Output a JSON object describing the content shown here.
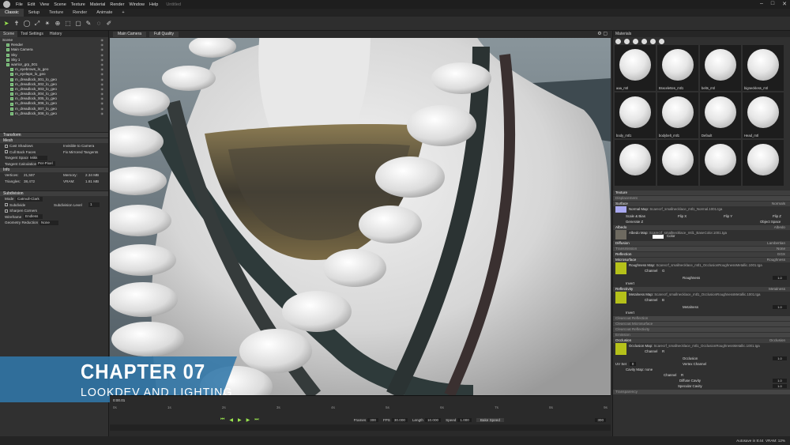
{
  "app": {
    "window_title": "Untitled"
  },
  "menu": [
    "File",
    "Edit",
    "View",
    "Scene",
    "Texture",
    "Material",
    "Render",
    "Window",
    "Help"
  ],
  "tabs": [
    {
      "label": "Classic"
    },
    {
      "label": "Setup"
    },
    {
      "label": "Texture"
    },
    {
      "label": "Render"
    },
    {
      "label": "Animate"
    },
    {
      "label": "+"
    }
  ],
  "left": {
    "tabs": [
      "Scene",
      "Tool Settings",
      "History"
    ],
    "tree": [
      "Scene",
      "Render",
      "Main Camera",
      "Sky",
      "Sky 1",
      "warrior_grp_001",
      "m_eyebrows_lo_geo",
      "m_eyelaps_lo_geo",
      "m_dreadlock_001_lo_geo",
      "m_dreadlock_002_lo_geo",
      "m_dreadlock_003_lo_geo",
      "m_dreadlock_004_lo_geo",
      "m_dreadlock_005_lo_geo",
      "m_dreadlock_006_lo_geo",
      "m_dreadlock_007_lo_geo",
      "m_dreadlock_008_lo_geo"
    ],
    "transform": "Transform",
    "mesh": "Mesh",
    "cast_shadows": "Cast Shadows",
    "invisible_camera": "Invisible to Camera",
    "cull_back": "Cull Back Faces",
    "fix_mirrored": "Fix Mirrored Tangents",
    "tangent_space": "Tangent Space",
    "tangent_space_val": "Mikk",
    "tangent_calc": "Tangent Calculation",
    "tangent_calc_val": "Per-Pixel",
    "info": "Info",
    "vertices_label": "Vertices:",
    "vertices": "21,587",
    "memory_label": "Memory:",
    "memory": "2.34 MB",
    "triangles_label": "Triangles:",
    "triangles": "38,472",
    "vram_label": "VRAM:",
    "vram": "1.81 MB",
    "subdivision": "Subdivision",
    "mode_label": "Mode",
    "mode_val": "Catmull-Clark",
    "subdivide": "Subdivide",
    "subdiv_level": "Subdivision Level",
    "subdiv_level_val": "1",
    "sharpen": "Sharpen Corners",
    "wireframe": "Wireframe",
    "wireframe_val": "Endless",
    "geom_reduction": "Geometry Reduction",
    "geom_reduction_val": "None"
  },
  "viewport": {
    "camera": "Main Camera",
    "quality": "Full Quality"
  },
  "timeline": {
    "time": "0:00.01",
    "ticks": [
      "0s",
      "1s",
      "2s",
      "3s",
      "4s",
      "5s",
      "6s",
      "7s",
      "8s",
      "9s"
    ],
    "frames_label": "Frames",
    "frames": "300",
    "fps_label": "FPS",
    "fps": "30.000",
    "length_label": "Length",
    "length": "10.000",
    "speed_label": "Speed",
    "speed": "1.000",
    "bake_speed": "Bake Speed",
    "end_val": "300"
  },
  "right": {
    "title": "Materials",
    "materials": [
      "aaa_mtl",
      "Bracelettes_mtl1",
      "belts_mtl",
      "bigneckless_mtl",
      "body_mtl1",
      "bodybelt_mtl1",
      "Default",
      "Head_mtl",
      "",
      "",
      "",
      ""
    ],
    "sections": {
      "texture": "Texture",
      "displacement": "Displacement",
      "surface": "Surface",
      "surface_r": "Normals",
      "normal_map": "Normal Map:",
      "normal_file": "Scarecrf_smallnecklace_mtl1_Normal.1001.tga",
      "scale_bias": "Scale & Bias",
      "flip_x": "Flip X",
      "flip_y": "Flip Y",
      "flip_z": "Flip Z",
      "generate_z": "Generate Z",
      "object_space": "Object Space",
      "albedo": "Albedo",
      "albedo_r": "Albedo",
      "albedo_map": "Albedo Map:",
      "albedo_file": "Scarecrf_smallnecklace_mtl1_BaseColor.1001.tga",
      "color": "Color",
      "diffusion": "Diffusion",
      "diffusion_r": "Lambertian",
      "transmission": "Transmission",
      "transmission_r": "None",
      "reflection": "Reflection",
      "reflection_r": "GGX",
      "microsurface": "Microsurface",
      "microsurface_r": "Roughness",
      "roughness_map": "Roughness Map:",
      "roughness_file": "Scarecrf_smallnecklace_mtl1_OcclusionRoughnessMetallic.1001.tga",
      "channel": "Channel",
      "channel_g": "G",
      "roughness": "Roughness",
      "one": "1.0",
      "invert": "Invert",
      "reflectivity": "Reflectivity",
      "reflectivity_r": "Metalness",
      "metalness_map": "Metalness Map:",
      "metalness_file": "Scarecrf_smallnecklace_mtl1_OcclusionRoughnessMetallic.1001.tga",
      "channel_b": "B",
      "metalness": "Metalness",
      "clearcoat_refl": "Clearcoat Reflection",
      "clearcoat_micro": "Clearcoat Microsurface",
      "clearcoat_reflectivity": "Clearcoat Reflectivity",
      "emission": "Emission",
      "occlusion": "Occlusion",
      "occlusion_r": "Occlusion",
      "occlusion_map": "Occlusion Map:",
      "occlusion_file": "Scarecrf_smallnecklace_mtl1_OcclusionRoughnessMetallic.1001.tga",
      "channel_r": "R",
      "occlusion_lbl": "Occlusion",
      "uv_set": "UV Set",
      "uv_val": "0",
      "vertex_channel": "Vertex Channel",
      "cavity_map": "Cavity Map:",
      "cavity_none": "none",
      "diffuse_cavity": "Diffuse Cavity",
      "specular_cavity": "Specular Cavity",
      "transparency": "Transparency"
    }
  },
  "status": {
    "autosave": "Autosave in 8:44",
    "vram": "VRAM: 12%"
  },
  "banner": {
    "chapter": "CHAPTER 07",
    "subtitle": "LOOKDEV AND LIGHTING"
  }
}
